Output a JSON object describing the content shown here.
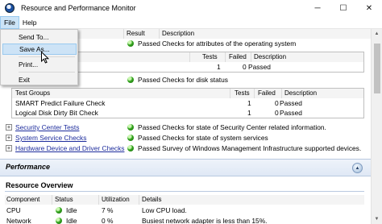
{
  "window": {
    "title": "Resource and Performance Monitor",
    "minimize_glyph": "─",
    "maximize_glyph": "☐",
    "close_glyph": "✕",
    "icon": "performance-monitor-icon"
  },
  "menubar": {
    "items": [
      {
        "label": "File",
        "active": true
      },
      {
        "label": "Help",
        "active": false
      }
    ]
  },
  "file_menu": {
    "items": [
      {
        "label": "Send To..."
      },
      {
        "label": "Save As...",
        "hover": true
      },
      {
        "label": "Print..."
      },
      {
        "label": "Exit"
      }
    ]
  },
  "checks_table": {
    "columns": [
      "Result",
      "Description"
    ],
    "top_rows": [
      {
        "result": "Passed",
        "description": "Checks for attributes of the operating system"
      }
    ],
    "subtable1": {
      "columns": [
        "Tests",
        "Failed",
        "Description"
      ],
      "rows": [
        {
          "tests": "1",
          "failed": "0",
          "description": "Passed"
        }
      ]
    },
    "disk_row": {
      "result": "Passed",
      "description": "Checks for disk status"
    },
    "subtable2": {
      "columns": [
        "Test Groups",
        "Tests",
        "Failed",
        "Description"
      ],
      "rows": [
        {
          "name": "SMART Predict Failure Check",
          "tests": "1",
          "failed": "0",
          "description": "Passed"
        },
        {
          "name": "Logical Disk Dirty Bit Check",
          "tests": "1",
          "failed": "0",
          "description": "Passed"
        }
      ]
    },
    "group_rows": [
      {
        "name": "Security Center Tests",
        "result": "Passed",
        "description": "Checks for state of Security Center related information."
      },
      {
        "name": "System Service Checks",
        "result": "Passed",
        "description": "Checks for state of system services"
      },
      {
        "name": "Hardware Device and Driver Checks",
        "result": "Passed",
        "description": "Survey of Windows Management Infrastructure supported devices."
      }
    ]
  },
  "performance": {
    "title": "Performance",
    "collapse_glyph": "▲",
    "resource_overview": {
      "title": "Resource Overview",
      "columns": [
        "Component",
        "Status",
        "Utilization",
        "Details"
      ],
      "rows": [
        {
          "component": "CPU",
          "status": "Idle",
          "utilization": "7 %",
          "details": "Low CPU load."
        },
        {
          "component": "Network",
          "status": "Idle",
          "utilization": "0 %",
          "details": "Busiest network adapter is less than 15%."
        }
      ]
    }
  },
  "colors": {
    "passed_green": "#34a51f",
    "link_blue": "#1d2c9c",
    "menu_hover": "#cde3f6",
    "section_bar": "#dfe8f5"
  }
}
